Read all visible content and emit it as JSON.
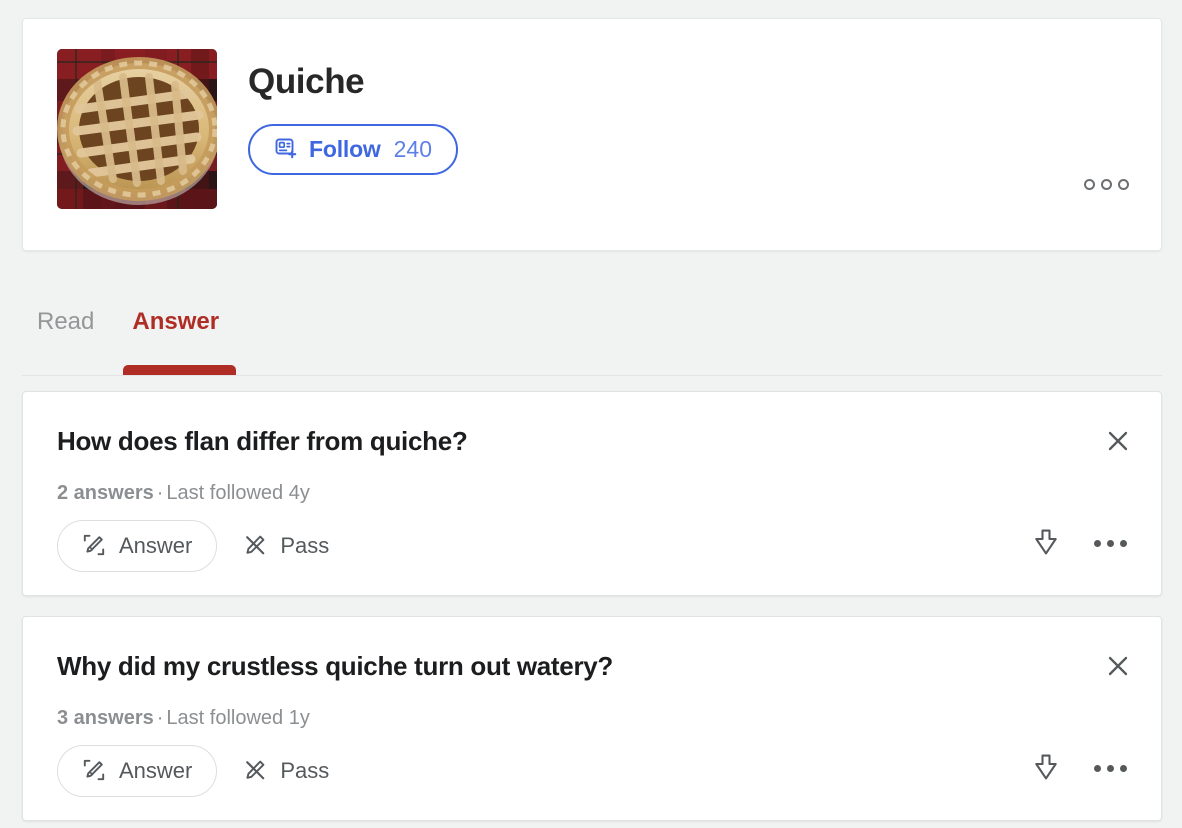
{
  "topic": {
    "title": "Quiche",
    "thumbnail_alt": "lattice-top pie on red plaid tablecloth",
    "follow_label": "Follow",
    "follow_count": "240",
    "more_icon": "more-horizontal-icon"
  },
  "tabs": [
    {
      "label": "Read",
      "active": false
    },
    {
      "label": "Answer",
      "active": true
    }
  ],
  "questions": [
    {
      "title": "How does flan differ from quiche?",
      "answers_count": "2 answers",
      "separator": "·",
      "last_followed": "Last followed 4y",
      "answer_label": "Answer",
      "pass_label": "Pass",
      "close_icon": "close-icon",
      "downvote_icon": "downvote-arrow-icon",
      "more_icon": "more-horizontal-icon"
    },
    {
      "title": "Why did my crustless quiche turn out watery?",
      "answers_count": "3 answers",
      "separator": "·",
      "last_followed": "Last followed 1y",
      "answer_label": "Answer",
      "pass_label": "Pass",
      "close_icon": "close-icon",
      "downvote_icon": "downvote-arrow-icon",
      "more_icon": "more-horizontal-icon"
    }
  ],
  "colors": {
    "page_background": "#f1f2f2",
    "card_background": "#ffffff",
    "accent_blue": "#3f68e0",
    "accent_red": "#b02d26",
    "text_primary": "#1c1d1f",
    "text_muted": "#8c8f92",
    "icon_gray": "#56595c"
  }
}
